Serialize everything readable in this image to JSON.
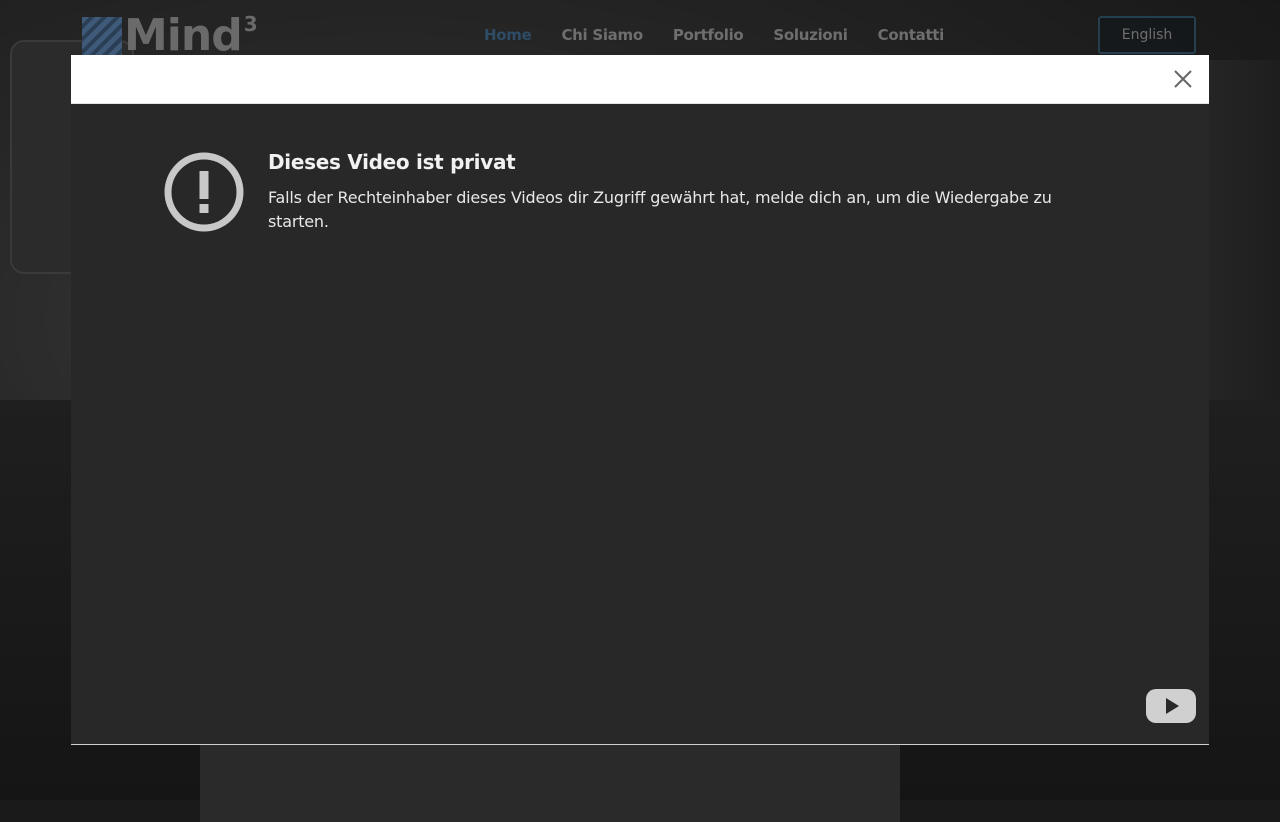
{
  "header": {
    "logo_text": "Mind",
    "logo_sup": "3",
    "nav": [
      {
        "label": "Home",
        "active": true
      },
      {
        "label": "Chi Siamo",
        "active": false
      },
      {
        "label": "Portfolio",
        "active": false
      },
      {
        "label": "Soluzioni",
        "active": false
      },
      {
        "label": "Contatti",
        "active": false
      }
    ],
    "language_button": "English"
  },
  "modal": {
    "close_icon": "close-icon",
    "video": {
      "alert_icon": "exclamation-circle-icon",
      "title": "Dieses Video ist privat",
      "message": "Falls der Rechteinhaber dieses Videos dir Zugriff gewährt hat, melde dich an, um die Wiedergabe zu starten.",
      "brand_icon": "youtube-play-icon"
    }
  },
  "colors": {
    "nav_active": "#2e4c66",
    "modal_bg": "#282828",
    "modal_header": "#ffffff"
  }
}
